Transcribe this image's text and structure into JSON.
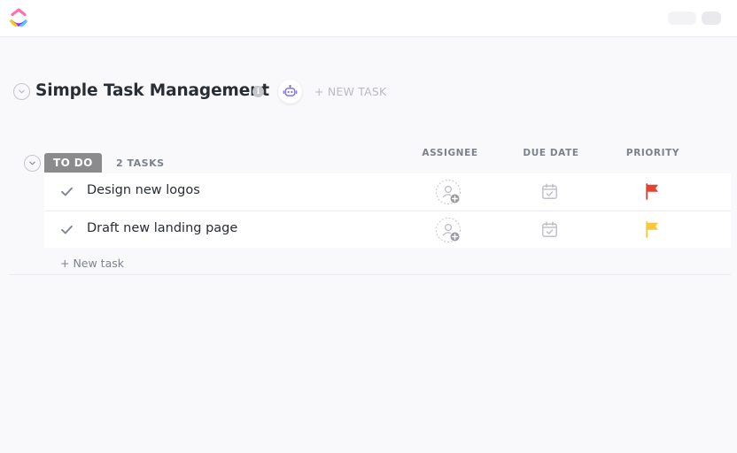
{
  "app": {
    "logo": "clickup-logo",
    "colors": {
      "accent": "#7b68ee",
      "logo_pink": "#fd71af",
      "logo_purple": "#8930fd",
      "logo_blue": "#49ccf9",
      "logo_orange": "#ffc800"
    }
  },
  "list": {
    "title": "Simple Task Management",
    "info_icon": "i",
    "new_task_label": "+ NEW TASK"
  },
  "group": {
    "status": "TO DO",
    "count": "2 TASKS",
    "status_color": "#8b8b8e"
  },
  "columns": [
    "ASSIGNEE",
    "DUE DATE",
    "PRIORITY"
  ],
  "tasks": [
    {
      "name": "Design new logos",
      "assignee": "unassigned",
      "due_date": "",
      "priority": "urgent",
      "priority_color": "#e44332"
    },
    {
      "name": "Draft new landing page",
      "assignee": "unassigned",
      "due_date": "",
      "priority": "high",
      "priority_color": "#f8c839"
    }
  ],
  "add_task_label": "+ New task"
}
